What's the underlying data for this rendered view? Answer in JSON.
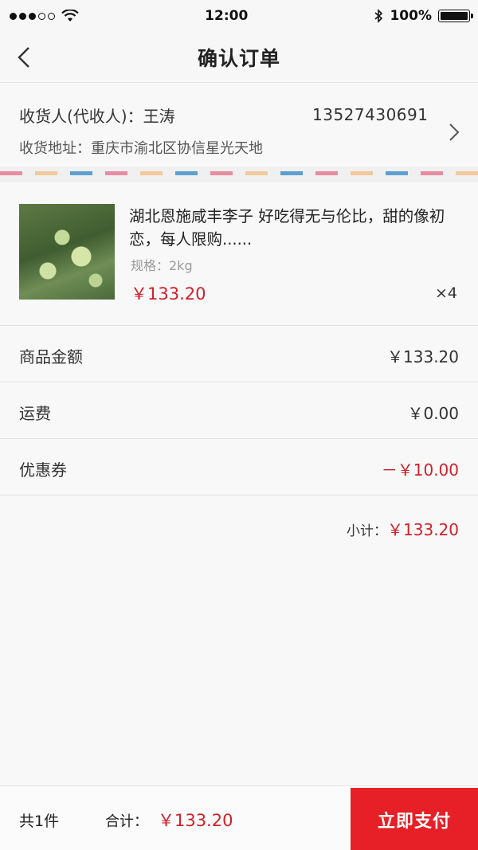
{
  "status_bar": {
    "time": "12:00",
    "battery": "100%",
    "signal_dots": [
      true,
      true,
      true,
      false,
      false
    ],
    "battery_level": 1.0,
    "icons": [
      "wifi-icon",
      "bluetooth-icon",
      "battery-icon"
    ]
  },
  "nav": {
    "title": "确认订单",
    "back_icon": "chevron-left-icon"
  },
  "address": {
    "recipient_line": "收货人(代收人)：王涛",
    "phone": "13527430691",
    "address_line": "收货地址：重庆市渝北区协信星光天地"
  },
  "product": {
    "title": "湖北恩施咸丰李子 好吃得无与伦比，甜的像初恋，每人限购......",
    "spec": "规格：2kg",
    "price": "￥133.20",
    "quantity": "×4"
  },
  "fees": [
    {
      "label": "商品金额",
      "value": "￥133.20",
      "highlight": false
    },
    {
      "label": "运费",
      "value": "￥0.00",
      "highlight": false
    },
    {
      "label": "优惠券",
      "value": "－￥10.00",
      "highlight": true
    }
  ],
  "subtotal": {
    "label": "小计：",
    "value": "￥133.20"
  },
  "bottom_bar": {
    "count": "共1件",
    "total_label": "合计：",
    "total_value": "￥133.20",
    "pay_button": "立即支付"
  },
  "colors": {
    "accent_red": "#e62026",
    "price_red": "#d0202a",
    "stripe_pink": "#e98ca2",
    "stripe_peach": "#f3c99b",
    "stripe_blue": "#5c9fd0"
  }
}
